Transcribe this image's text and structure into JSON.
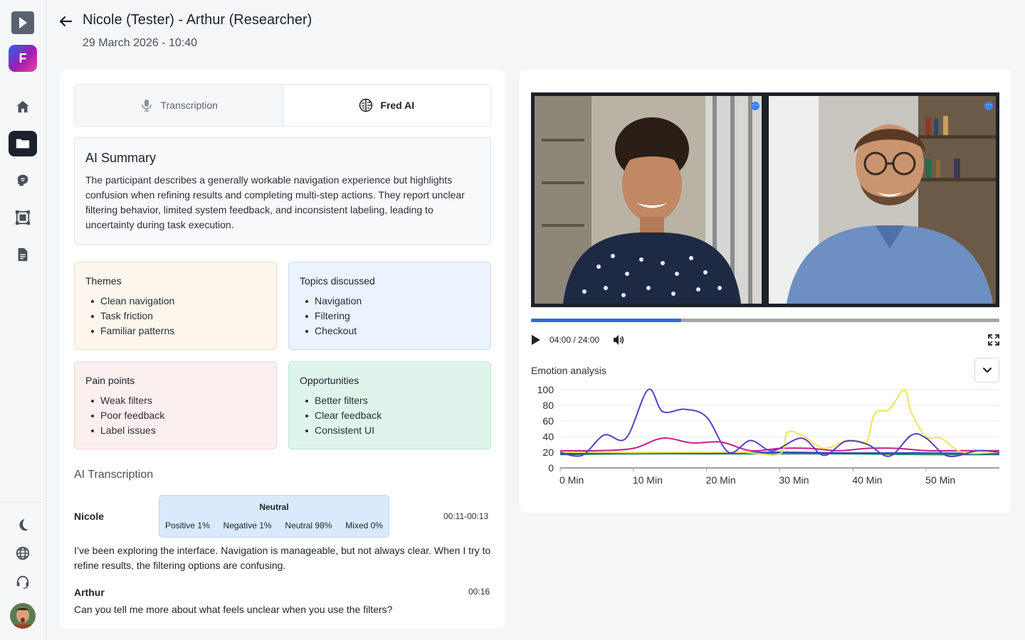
{
  "header": {
    "title": "Nicole (Tester) - Arthur (Researcher)",
    "date": "29 March 2026 - 10:40"
  },
  "sidebar": {
    "logo_letter": "F",
    "items": [
      "home-icon",
      "folder-icon",
      "brain-icon",
      "board-icon",
      "document-icon"
    ],
    "active_item": "folder-icon",
    "bottom_items": [
      "moon-icon",
      "globe-icon",
      "headset-icon"
    ]
  },
  "tabs": [
    {
      "label": "Transcription",
      "active": false
    },
    {
      "label": "Fred AI",
      "active": true
    }
  ],
  "summary": {
    "title": "AI Summary",
    "text": "The participant describes a generally workable navigation experience but highlights confusion when refining results and completing multi-step actions. They report unclear filtering behavior, limited system feedback, and inconsistent labeling, leading to uncertainty during task execution."
  },
  "cards": {
    "themes": {
      "title": "Themes",
      "items": [
        "Clean navigation",
        "Task friction",
        "Familiar patterns"
      ]
    },
    "topics": {
      "title": "Topics discussed",
      "items": [
        "Navigation",
        "Filtering",
        "Checkout"
      ]
    },
    "pain": {
      "title": "Pain points",
      "items": [
        "Weak filters",
        "Poor feedback",
        "Label issues"
      ]
    },
    "opportunities": {
      "title": "Opportunities",
      "items": [
        "Better filters",
        "Clear feedback",
        "Consistent UI"
      ]
    }
  },
  "transcription": {
    "title": "AI Transcription",
    "entries": [
      {
        "speaker": "Nicole",
        "time": "00:11-00:13",
        "sentiment": {
          "label": "Neutral",
          "positive": "Positive 1%",
          "negative": "Negative 1%",
          "neutral": "Neutral 98%",
          "mixed": "Mixed 0%"
        },
        "text": "I’ve been exploring the interface. Navigation is manageable, but not always clear. When I try to refine results, the filtering options are confusing."
      },
      {
        "speaker": "Arthur",
        "time": "00:16",
        "text": "Can you tell me more about what feels unclear when you use the filters?"
      }
    ]
  },
  "player": {
    "time": "04:00 / 24:00",
    "progress": 0.32
  },
  "emotion": {
    "title": "Emotion analysis"
  },
  "chart_data": {
    "type": "line",
    "x_ticks": [
      "0 Min",
      "10 Min",
      "20 Min",
      "30 Min",
      "40 Min",
      "50 Min"
    ],
    "y_ticks": [
      0,
      20,
      40,
      60,
      80,
      100
    ],
    "ylim": [
      0,
      100
    ],
    "xlim": [
      0,
      60
    ],
    "series": [
      {
        "color": "#5b3fc4",
        "x": [
          0,
          3,
          6,
          9,
          12,
          14,
          17,
          20,
          23,
          26,
          29,
          33,
          36,
          39,
          42,
          45,
          48,
          50,
          53,
          57,
          60
        ],
        "y": [
          20,
          16,
          42,
          38,
          100,
          72,
          75,
          65,
          20,
          35,
          22,
          38,
          16,
          34,
          30,
          15,
          42,
          38,
          15,
          22,
          20
        ]
      },
      {
        "color": "#f1e35d",
        "x": [
          0,
          5,
          10,
          15,
          20,
          25,
          30,
          31,
          33,
          36,
          39,
          41,
          42,
          43,
          45,
          47,
          48,
          50,
          52,
          55,
          60
        ],
        "y": [
          20,
          20,
          20,
          20,
          20,
          20,
          18,
          45,
          42,
          25,
          35,
          34,
          35,
          70,
          75,
          100,
          70,
          40,
          38,
          20,
          20
        ]
      },
      {
        "color": "#c81e8a",
        "x": [
          0,
          5,
          10,
          14,
          18,
          22,
          26,
          30,
          34,
          38,
          42,
          46,
          50,
          55,
          60
        ],
        "y": [
          22,
          22,
          25,
          38,
          32,
          33,
          22,
          25,
          25,
          22,
          25,
          25,
          22,
          22,
          22
        ]
      },
      {
        "color": "#2743a8",
        "x": [
          0,
          10,
          20,
          30,
          40,
          50,
          60
        ],
        "y": [
          18,
          20,
          19,
          20,
          19,
          19,
          18
        ]
      },
      {
        "color": "#1f8a70",
        "x": [
          0,
          10,
          20,
          30,
          40,
          50,
          60
        ],
        "y": [
          17,
          18,
          18,
          18,
          18,
          17,
          17
        ]
      }
    ]
  }
}
